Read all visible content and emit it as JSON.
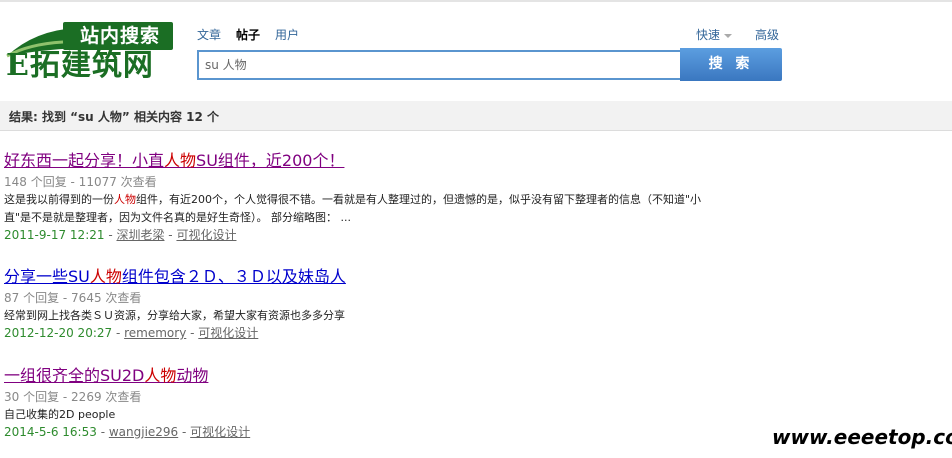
{
  "logo": {
    "caption": "站内搜索",
    "main": "E拓建筑网",
    "color": "#1b6e24"
  },
  "tabs": [
    {
      "label": "文章",
      "active": false
    },
    {
      "label": "帖子",
      "active": true
    },
    {
      "label": "用户",
      "active": false
    }
  ],
  "right_links": {
    "quick": "快速",
    "advanced": "高级"
  },
  "search": {
    "value": "su 人物",
    "button": "搜 索"
  },
  "result_summary": "结果: 找到 “su 人物” 相关内容 12 个",
  "results": [
    {
      "title_parts": [
        "好东西一起分享！小直",
        "人物",
        "SU组件，近200个！"
      ],
      "stats": "148 个回复 - 11077 次查看",
      "snippet_parts": [
        "这是我以前得到的一份",
        "人物",
        "组件，有近200个，个人觉得很不错。一看就是有人整理过的，但遗憾的是，似乎没有留下整理者的信息（不知道\"小"
      ],
      "snippet_line2": "直\"是不是就是整理者，因为文件名真的是好生奇怪）。 部分缩略图： ...",
      "date": "2011-9-17 12:21",
      "author": "深圳老梁",
      "category": "可视化设计"
    },
    {
      "title_parts": [
        "分享一些SU",
        "人物",
        "组件包含２Ｄ、３Ｄ以及妹岛人"
      ],
      "stats": "87 个回复 - 7645 次查看",
      "snippet_parts": [
        "经常到网上找各类ＳＵ资源，分享给大家，希望大家有资源也多多分享",
        "",
        ""
      ],
      "snippet_line2": "",
      "date": "2012-12-20 20:27",
      "author": "rememory",
      "category": "可视化设计"
    },
    {
      "title_parts": [
        "一组很齐全的SU2D",
        "人物",
        "动物"
      ],
      "stats": "30 个回复 - 2269 次查看",
      "snippet_parts": [
        "自己收集的2D people",
        "",
        ""
      ],
      "snippet_line2": "",
      "date": "2014-5-6 16:53",
      "author": "wangjie296",
      "category": "可视化设计"
    }
  ],
  "watermark": "www.eeeetop.com",
  "colors": {
    "highlight": "#cc0000",
    "button": "#3a77c0",
    "date": "#2e8b2e"
  }
}
